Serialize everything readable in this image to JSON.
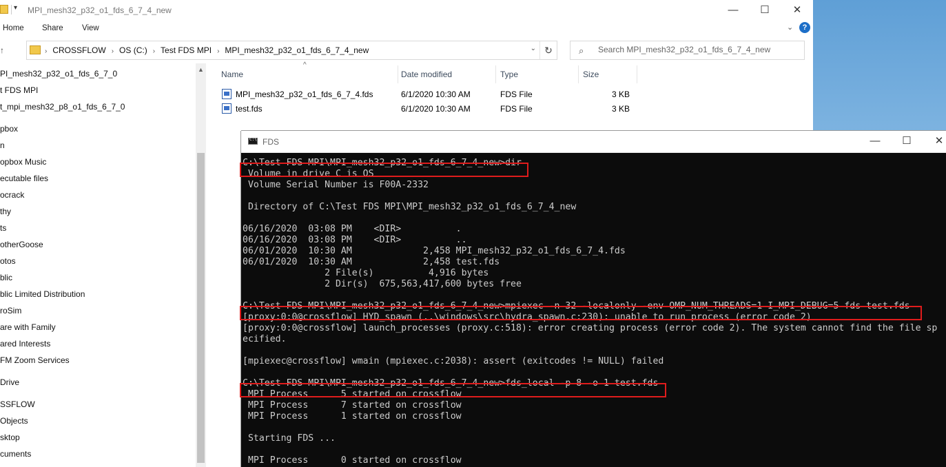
{
  "explorer": {
    "title": "MPI_mesh32_p32_o1_fds_6_7_4_new",
    "ribbon_tabs": [
      "Home",
      "Share",
      "View"
    ],
    "address_crumbs": [
      "CROSSFLOW",
      "OS (C:)",
      "Test FDS MPI",
      "MPI_mesh32_p32_o1_fds_6_7_4_new"
    ],
    "search_placeholder": "Search MPI_mesh32_p32_o1_fds_6_7_4_new",
    "nav_items": [
      "PI_mesh32_p32_o1_fds_6_7_0",
      "t FDS MPI",
      "t_mpi_mesh32_p8_o1_fds_6_7_0",
      "pbox",
      "n",
      "opbox Music",
      "ecutable files",
      "ocrack",
      "thy",
      "ts",
      "otherGoose",
      "otos",
      "blic",
      "blic Limited Distribution",
      "roSim",
      "are with Family",
      "ared Interests",
      "FM Zoom Services",
      "Drive",
      "SSFLOW",
      "Objects",
      "sktop",
      "cuments"
    ],
    "columns": {
      "name": "Name",
      "date": "Date modified",
      "type": "Type",
      "size": "Size"
    },
    "files": [
      {
        "name": "MPI_mesh32_p32_o1_fds_6_7_4.fds",
        "date": "6/1/2020 10:30 AM",
        "type": "FDS File",
        "size": "3 KB"
      },
      {
        "name": "test.fds",
        "date": "6/1/2020 10:30 AM",
        "type": "FDS File",
        "size": "3 KB"
      }
    ]
  },
  "console": {
    "title": "FDS",
    "lines": [
      "C:\\Test FDS MPI\\MPI_mesh32_p32_o1_fds_6_7_4_new>dir",
      " Volume in drive C is OS",
      " Volume Serial Number is F00A-2332",
      "",
      " Directory of C:\\Test FDS MPI\\MPI_mesh32_p32_o1_fds_6_7_4_new",
      "",
      "06/16/2020  03:08 PM    <DIR>          .",
      "06/16/2020  03:08 PM    <DIR>          ..",
      "06/01/2020  10:30 AM             2,458 MPI_mesh32_p32_o1_fds_6_7_4.fds",
      "06/01/2020  10:30 AM             2,458 test.fds",
      "               2 File(s)          4,916 bytes",
      "               2 Dir(s)  675,563,417,600 bytes free",
      "",
      "C:\\Test FDS MPI\\MPI_mesh32_p32_o1_fds_6_7_4_new>mpiexec -n 32 -localonly -env OMP_NUM_THREADS=1 I_MPI_DEBUG=5 fds test.fds",
      "[proxy:0:0@crossflow] HYD_spawn (..\\windows\\src\\hydra_spawn.c:230): unable to run process (error code 2)",
      "[proxy:0:0@crossflow] launch_processes (proxy.c:518): error creating process (error code 2). The system cannot find the file sp",
      "ecified.",
      "",
      "[mpiexec@crossflow] wmain (mpiexec.c:2038): assert (exitcodes != NULL) failed",
      "",
      "C:\\Test FDS MPI\\MPI_mesh32_p32_o1_fds_6_7_4_new>fds_local -p 8 -o 1 test.fds",
      " MPI Process      5 started on crossflow",
      " MPI Process      7 started on crossflow",
      " MPI Process      1 started on crossflow",
      "",
      " Starting FDS ...",
      "",
      " MPI Process      0 started on crossflow"
    ]
  }
}
